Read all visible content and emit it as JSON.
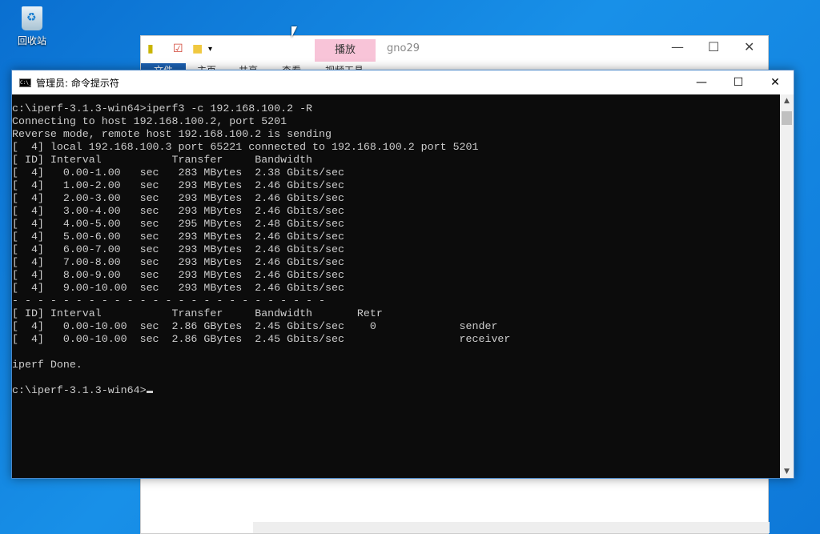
{
  "desktop": {
    "recycle_bin_label": "回收站"
  },
  "explorer": {
    "title": "gno29",
    "context_tab": "播放",
    "ribbon_tabs": [
      "文件",
      "主页",
      "共享",
      "查看",
      "视频工具"
    ],
    "minimize": "—",
    "maximize": "☐",
    "close": "✕"
  },
  "cmd": {
    "title": "管理员: 命令提示符",
    "icon_text": "C:\\_",
    "minimize": "—",
    "maximize": "☐",
    "close": "✕",
    "lines": [
      "c:\\iperf-3.1.3-win64>iperf3 -c 192.168.100.2 -R",
      "Connecting to host 192.168.100.2, port 5201",
      "Reverse mode, remote host 192.168.100.2 is sending",
      "[  4] local 192.168.100.3 port 65221 connected to 192.168.100.2 port 5201",
      "[ ID] Interval           Transfer     Bandwidth",
      "[  4]   0.00-1.00   sec   283 MBytes  2.38 Gbits/sec",
      "[  4]   1.00-2.00   sec   293 MBytes  2.46 Gbits/sec",
      "[  4]   2.00-3.00   sec   293 MBytes  2.46 Gbits/sec",
      "[  4]   3.00-4.00   sec   293 MBytes  2.46 Gbits/sec",
      "[  4]   4.00-5.00   sec   295 MBytes  2.48 Gbits/sec",
      "[  4]   5.00-6.00   sec   293 MBytes  2.46 Gbits/sec",
      "[  4]   6.00-7.00   sec   293 MBytes  2.46 Gbits/sec",
      "[  4]   7.00-8.00   sec   293 MBytes  2.46 Gbits/sec",
      "[  4]   8.00-9.00   sec   293 MBytes  2.46 Gbits/sec",
      "[  4]   9.00-10.00  sec   293 MBytes  2.46 Gbits/sec",
      "- - - - - - - - - - - - - - - - - - - - - - - - -",
      "[ ID] Interval           Transfer     Bandwidth       Retr",
      "[  4]   0.00-10.00  sec  2.86 GBytes  2.45 Gbits/sec    0             sender",
      "[  4]   0.00-10.00  sec  2.86 GBytes  2.45 Gbits/sec                  receiver",
      "",
      "iperf Done.",
      "",
      "c:\\iperf-3.1.3-win64>"
    ]
  }
}
